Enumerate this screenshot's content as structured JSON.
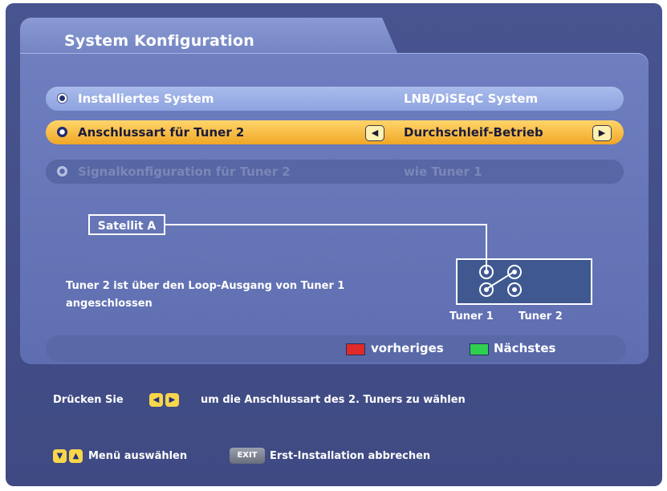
{
  "window": {
    "title": "System Konfiguration"
  },
  "menu": {
    "rows": [
      {
        "label": "Installiertes System",
        "value": "LNB/DiSEqC System",
        "state": "normal"
      },
      {
        "label": "Anschlussart für Tuner 2",
        "value": "Durchschleif-Betrieb",
        "state": "selected"
      },
      {
        "label": "Signalkonfiguration für Tuner 2",
        "value": "wie Tuner 1",
        "state": "disabled"
      }
    ]
  },
  "diagram": {
    "satellite": "Satellit A",
    "description_line1": "Tuner 2 ist über den Loop-Ausgang von Tuner 1",
    "description_line2": "angeschlossen",
    "tuner1": "Tuner 1",
    "tuner2": "Tuner 2"
  },
  "legend": {
    "red_label": "vorheriges",
    "green_label": "Nächstes",
    "red_color": "#e02a2a",
    "green_color": "#2fcf4f"
  },
  "hints": {
    "line1_prefix": "Drücken Sie",
    "line1_suffix": "um die Anschlussart des 2. Tuners zu wählen",
    "menu_select": "Menü auswählen",
    "exit_key": "EXIT",
    "exit_text": "Erst-Installation abbrechen"
  },
  "colors": {
    "background": "#48548f",
    "panel": "#6e7ebf",
    "selected_row": "#f0a726",
    "key_yellow": "#f7d64a"
  }
}
